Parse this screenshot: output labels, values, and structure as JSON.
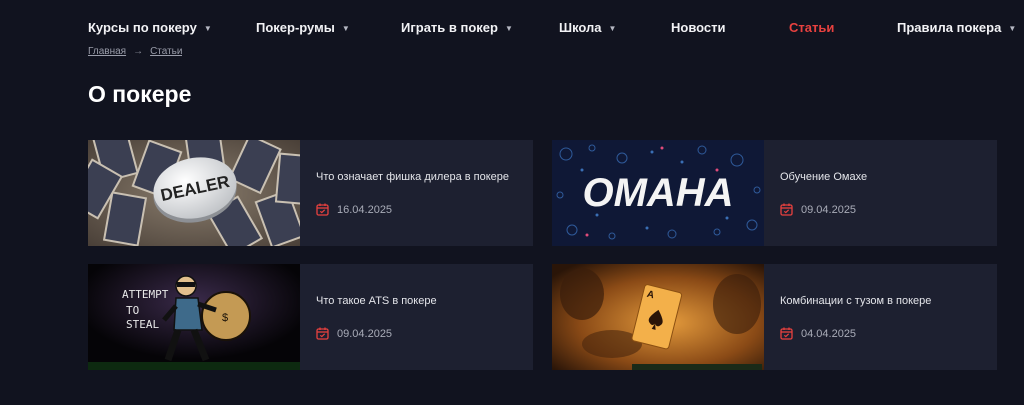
{
  "nav": {
    "items": [
      {
        "label": "Курсы по покеру",
        "caret": true,
        "active": false
      },
      {
        "label": "Покер-румы",
        "caret": true,
        "active": false
      },
      {
        "label": "Играть в покер",
        "caret": true,
        "active": false
      },
      {
        "label": "Школа",
        "caret": true,
        "active": false
      },
      {
        "label": "Новости",
        "caret": false,
        "active": false
      },
      {
        "label": "Статьи",
        "caret": false,
        "active": true
      },
      {
        "label": "Правила покера",
        "caret": true,
        "active": false
      }
    ]
  },
  "breadcrumb": {
    "home": "Главная",
    "separator": "→",
    "current": "Статьи"
  },
  "page": {
    "title": "О покере"
  },
  "articles": [
    {
      "title": "Что означает фишка дилера в покере",
      "date": "16.04.2025",
      "image_text": "DEALER"
    },
    {
      "title": "Обучение Омахе",
      "date": "09.04.2025",
      "image_text": "OMAHA"
    },
    {
      "title": "Что такое ATS в покере",
      "date": "09.04.2025",
      "image_text_1": "ATTEMPT",
      "image_text_2": "TO",
      "image_text_3": "STEAL"
    },
    {
      "title": "Комбинации с тузом в покере",
      "date": "04.04.2025",
      "image_text": "A"
    }
  ],
  "colors": {
    "background": "#11131f",
    "card": "#1d2030",
    "accent": "#e8413f"
  }
}
